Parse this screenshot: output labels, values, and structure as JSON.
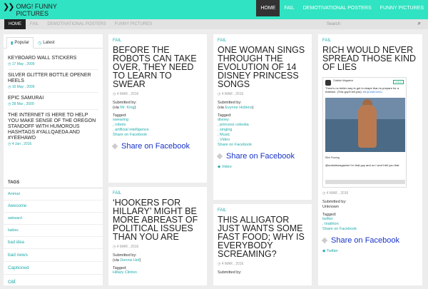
{
  "header": {
    "logo_text": "OMG! FUNNY PICTURES",
    "nav": [
      "HOME",
      "FAIL",
      "DEMOTIVATIONAL POSTERS",
      "FUNNY PICTURES"
    ]
  },
  "subnav": {
    "items": [
      "HOME",
      "FAIL",
      "DEMOTIVATIONAL POSTERS",
      "FUNNY PICTURES"
    ],
    "search_placeholder": "Search"
  },
  "sidebar": {
    "tabs": [
      "Popular",
      "Latest"
    ],
    "posts": [
      {
        "title": "KEYBOARD WALL STICKERS",
        "date": "17 May , 2009"
      },
      {
        "title": "SILVER GLITTER BOTTLE OPENER HEELS",
        "date": "16 May , 2009"
      },
      {
        "title": "EPIC SAMURAI",
        "date": "28 Mar , 2009"
      },
      {
        "title": "THE INTERNET IS HERE TO HELP YOU MAKE SENSE OF THE OREGON STANDOFF WITH HUMOROUS HASHTAGS #YALLQAEDA AND #YEEHAWD",
        "date": "4 Jan , 2016"
      }
    ],
    "tags_heading": "TAGS",
    "tags": [
      "Animal",
      "Awesome",
      "awkward",
      "babies",
      "bad idea",
      "bad news",
      "Captioned",
      "cat"
    ]
  },
  "cards": {
    "c1": {
      "cat": "FAIL",
      "title": "BEFORE THE ROBOTS CAN TAKE OVER, THEY NEED TO LEARN TO SWEAR",
      "date": "4 MAR , 2016",
      "submitted": "Submitted by:",
      "via_prefix": "(via ",
      "via": "Mr. King",
      "via_suffix": ")",
      "tagged": "Tagged:",
      "tags": [
        "swearing",
        ", robots",
        ", artificial intelligence"
      ],
      "share_link": "Share on Facebook",
      "share_btn": "Share on Facebook"
    },
    "c2": {
      "cat": "FAIL",
      "title": "ONE WOMAN SINGS THROUGH THE EVOLUTION OF 14 DISNEY PRINCESS SONGS",
      "date": "4 MAR , 2016",
      "submitted": "Submitted by:",
      "via_prefix": "(via ",
      "via": "Evynne Hollens",
      "via_suffix": ")",
      "tagged": "Tagged:",
      "tags": [
        "disney",
        ", princess celestia",
        ", singing",
        ", Music",
        ", Video"
      ],
      "share_link": "Share on Facebook",
      "share_btn": "Share on Facebook",
      "cat_footer": "Video"
    },
    "c3": {
      "cat": "FAIL",
      "title": "RICH WOULD NEVER SPREAD THOSE KIND OF LIES",
      "tweet_name": "Outside Magazine",
      "tweet_follow": "Follow",
      "tweet_text": "There's no better way to get in shape than to prepare for a triathlon. (This guy'll tell you):",
      "tweet_link": "bit.ly/1wD1zKU",
      "reply_name": "Rich Froning",
      "reply_text": "@outsidemagazine I'm that guy and no I won't tell you that",
      "date": "4 MAR , 2016",
      "submitted": "Submitted by:",
      "author": "Unknown",
      "tagged": "Tagged:",
      "tags": [
        "twitter",
        ", triathlon"
      ],
      "share_link": "Share on Facebook",
      "share_btn": "Share on Facebook",
      "cat_footer": "Twitter"
    },
    "c4": {
      "cat": "FAIL",
      "title": "‘HOOKERS FOR HILLARY’ MIGHT BE MORE ABREAST OF POLITICAL ISSUES THAN YOU ARE",
      "date": "4 MAR , 2016",
      "submitted": "Submitted by:",
      "via_prefix": "(via ",
      "via": "Dennis Hof",
      "via_suffix": ")",
      "tagged": "Tagged:",
      "tags": [
        "Hillary Clinton"
      ]
    },
    "c5": {
      "cat": "FAIL",
      "title": "THIS ALLIGATOR JUST WANTS SOME FAST FOOD; WHY IS EVERYBODY SCREAMING?",
      "date": "4 MAR , 2016",
      "submitted": "Submitted by:"
    }
  },
  "colors": {
    "accent": "#30e3c2",
    "link": "#22aaaa",
    "facebook": "#1833c8"
  }
}
